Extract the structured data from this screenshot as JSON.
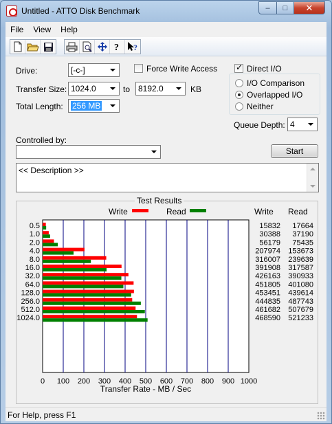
{
  "window": {
    "title": "Untitled - ATTO Disk Benchmark"
  },
  "caption_buttons": {
    "minimize": "–",
    "maximize": "□",
    "close": "✕"
  },
  "menu": [
    "File",
    "View",
    "Help"
  ],
  "toolbar_icons": [
    "new-file-icon",
    "open-folder-icon",
    "save-icon",
    "print-icon",
    "print-preview-icon",
    "move-icon",
    "help-icon",
    "context-help-icon"
  ],
  "form": {
    "drive_label": "Drive:",
    "drive_value": "[-c-]",
    "force_write_access_label": "Force Write Access",
    "force_write_access_checked": false,
    "direct_io_label": "Direct I/O",
    "direct_io_checked": true,
    "transfer_size_label": "Transfer Size:",
    "transfer_size_from": "1024.0",
    "to_label": "to",
    "transfer_size_to": "8192.0",
    "kb_label": "KB",
    "total_length_label": "Total Length:",
    "total_length_value": "256 MB",
    "io_mode_options": [
      "I/O Comparison",
      "Overlapped I/O",
      "Neither"
    ],
    "io_mode_selected": "Overlapped I/O",
    "queue_depth_label": "Queue Depth:",
    "queue_depth_value": "4",
    "controlled_by_label": "Controlled by:",
    "controlled_by_value": "",
    "start_button": "Start",
    "description": "<< Description >>"
  },
  "results": {
    "title": "Test Results",
    "write_legend": "Write",
    "read_legend": "Read",
    "write_header": "Write",
    "read_header": "Read",
    "colors": {
      "write": "#ff0000",
      "read": "#008000",
      "grid": "#000080"
    }
  },
  "chart_data": {
    "type": "bar",
    "orientation": "horizontal",
    "title": "Test Results",
    "xlabel": "Transfer Rate - MB / Sec",
    "ylabel": "",
    "xlim": [
      0,
      1000
    ],
    "xticks": [
      "0",
      "100",
      "200",
      "300",
      "400",
      "500",
      "600",
      "700",
      "800",
      "900",
      "1000"
    ],
    "categories": [
      "0.5",
      "1.0",
      "2.0",
      "4.0",
      "8.0",
      "16.0",
      "32.0",
      "64.0",
      "128.0",
      "256.0",
      "512.0",
      "1024.0"
    ],
    "series": [
      {
        "name": "Write",
        "values": [
          15.5,
          29.7,
          54.9,
          203.1,
          308.6,
          382.7,
          416.2,
          441.2,
          442.8,
          434.4,
          450.9,
          457.6
        ]
      },
      {
        "name": "Read",
        "values": [
          17.2,
          36.3,
          73.7,
          150.0,
          234.0,
          310.1,
          381.8,
          391.6,
          429.3,
          476.3,
          495.8,
          509.0
        ]
      }
    ],
    "table_write": [
      "15832",
      "30388",
      "56179",
      "207974",
      "316007",
      "391908",
      "426163",
      "451805",
      "453451",
      "444835",
      "461682",
      "468590"
    ],
    "table_read": [
      "17664",
      "37190",
      "75435",
      "153673",
      "239639",
      "317587",
      "390933",
      "401080",
      "439614",
      "487743",
      "507679",
      "521233"
    ]
  },
  "status": {
    "text": "For Help, press F1"
  }
}
